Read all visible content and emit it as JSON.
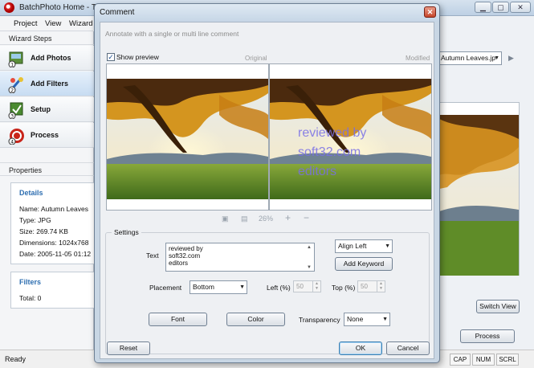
{
  "main_window": {
    "title": "BatchPhoto Home - Tria",
    "menu": [
      "Project",
      "View",
      "Wizard"
    ],
    "wizard_steps_header": "Wizard Steps",
    "steps": [
      {
        "label": "Add Photos",
        "icon": "add-photos-icon"
      },
      {
        "label": "Add Filters",
        "icon": "add-filters-icon"
      },
      {
        "label": "Setup",
        "icon": "setup-icon"
      },
      {
        "label": "Process",
        "icon": "process-icon"
      }
    ],
    "properties_header": "Properties",
    "details": {
      "title": "Details",
      "name": "Name: Autumn Leaves",
      "type": "Type: JPG",
      "size": "Size: 269.74 KB",
      "dimensions": "Dimensions: 1024x768",
      "date": "Date: 2005-11-05 01:12"
    },
    "filters": {
      "title": "Filters",
      "total": "Total: 0"
    },
    "right": {
      "file_select": "Autumn Leaves.jp",
      "switch_view": "Switch View",
      "process": "Process"
    },
    "status": {
      "text": "Ready",
      "cap": "CAP",
      "num": "NUM",
      "scrl": "SCRL"
    }
  },
  "dialog": {
    "title": "Comment",
    "hint": "Annotate with a single or multi line comment",
    "show_preview_label": "Show preview",
    "show_preview_checked": true,
    "original_label": "Original",
    "modified_label": "Modified",
    "zoom": "26%",
    "overlay_lines": [
      "reviewed by",
      "soft32.com",
      "editors"
    ],
    "settings": {
      "legend": "Settings",
      "text_label": "Text",
      "text_lines": [
        "reviewed by",
        "soft32.com",
        "editors"
      ],
      "align": "Align Left",
      "add_keyword": "Add Keyword",
      "placement_label": "Placement",
      "placement": "Bottom",
      "left_label": "Left (%)",
      "left_value": "50",
      "top_label": "Top (%)",
      "top_value": "50",
      "font_button": "Font",
      "color_button": "Color",
      "transparency_label": "Transparency",
      "transparency": "None"
    },
    "reset": "Reset",
    "ok": "OK",
    "cancel": "Cancel"
  }
}
